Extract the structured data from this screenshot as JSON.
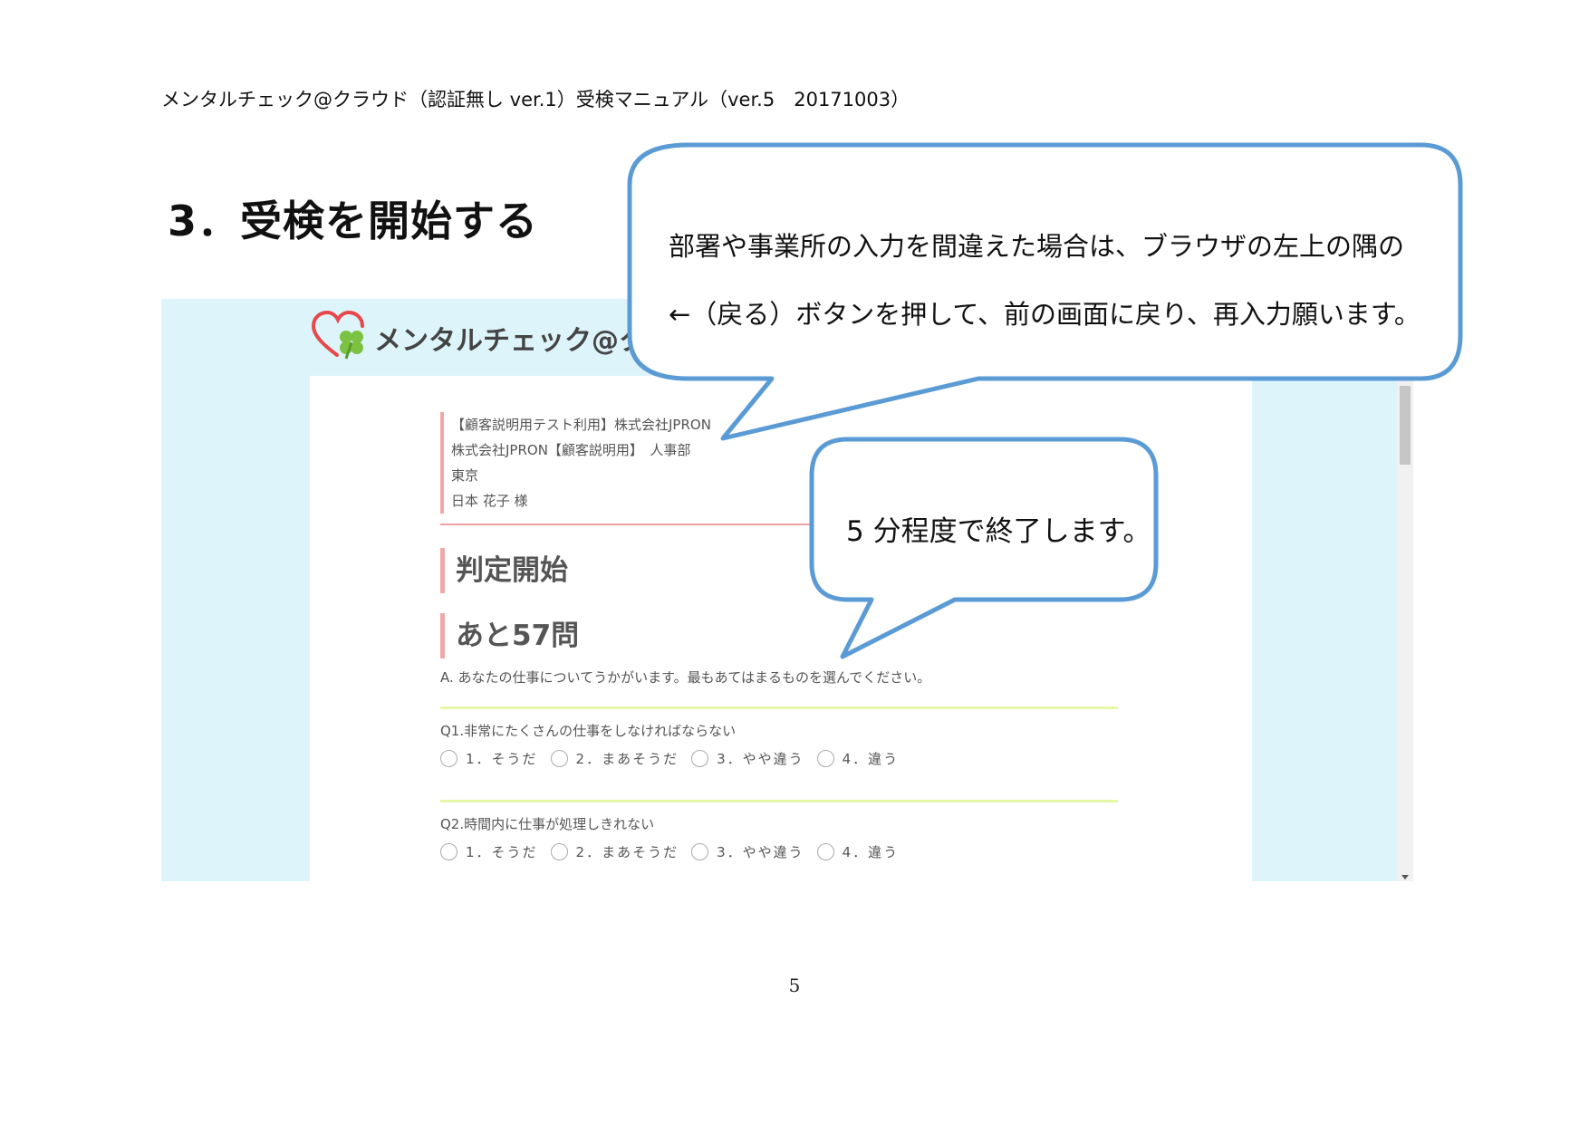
{
  "document": {
    "header": "メンタルチェック@クラウド（認証無し ver.1）受検マニュアル（ver.5　20171003）",
    "section_title": "3．受検を開始する",
    "page_number": "5"
  },
  "screenshot": {
    "app_name": "メンタルチェック@クラ",
    "info_lines": [
      "【顧客説明用テスト利用】株式会社JPRON",
      "株式会社JPRON【顧客説明用】　人事部",
      "東京",
      "日本 花子 様"
    ],
    "heading_start": "判定開始",
    "remaining": "あと57問",
    "intro": "A. あなたの仕事についてうかがいます。最もあてはまるものを選んでください。",
    "questions": [
      {
        "text": "Q1.非常にたくさんの仕事をしなければならない"
      },
      {
        "text": "Q2.時間内に仕事が処理しきれない"
      }
    ],
    "options": [
      "1．そうだ",
      "2．まあそうだ",
      "3．やや違う",
      "4．違う"
    ]
  },
  "callouts": {
    "main_line1": "部署や事業所の入力を間違えた場合は、ブラウザの左上の隅の",
    "main_line2": "←（戻る）ボタンを押して、前の画面に戻り、再入力願います。",
    "duration": "5 分程度で終了します。"
  },
  "colors": {
    "callout_border": "#5b9bd5",
    "screenshot_bg": "#ddf5fa",
    "accent_pink": "#f2a7a7",
    "rule_green": "#e6f7a6",
    "clover_green": "#7bc142",
    "heart_red": "#e8474b"
  }
}
